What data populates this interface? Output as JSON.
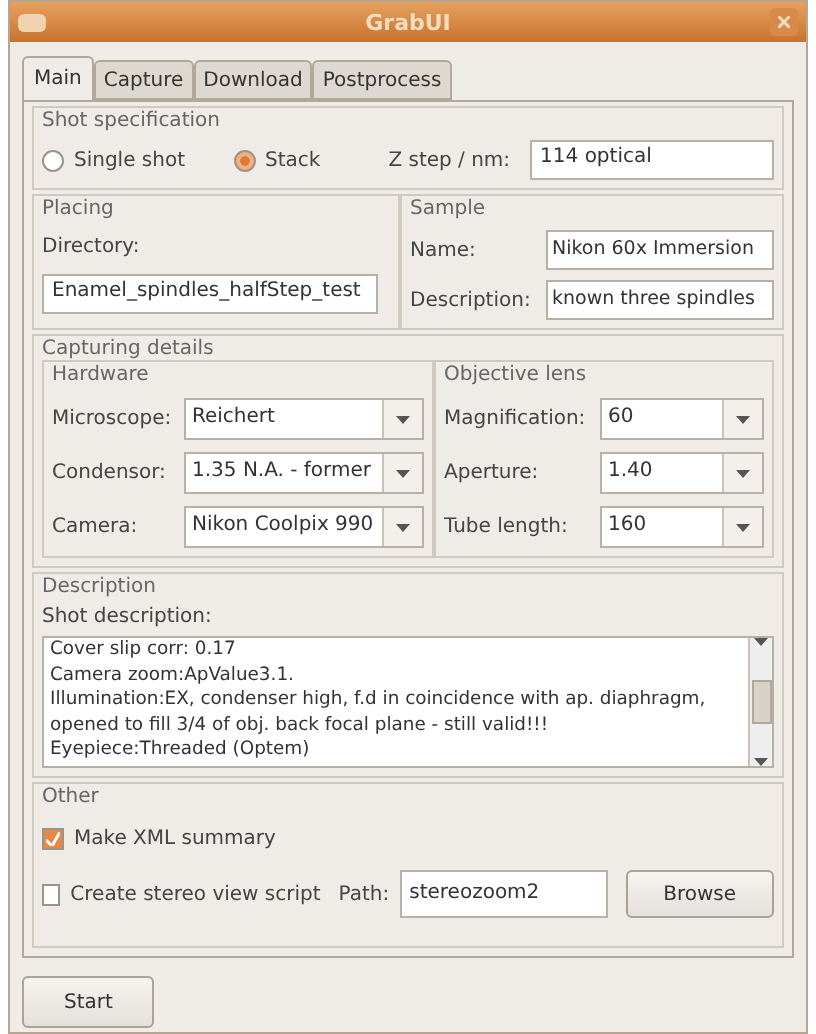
{
  "window": {
    "title": "GrabUI"
  },
  "tabs": [
    {
      "label": "Main",
      "selected": true
    },
    {
      "label": "Capture",
      "selected": false
    },
    {
      "label": "Download",
      "selected": false
    },
    {
      "label": "Postprocess",
      "selected": false
    }
  ],
  "shot_specification": {
    "title": "Shot specification",
    "options": [
      {
        "label": "Single shot",
        "selected": false
      },
      {
        "label": "Stack",
        "selected": true
      }
    ],
    "z_step": {
      "label": "Z step / nm:",
      "value": "114 optical"
    }
  },
  "placing": {
    "title": "Placing",
    "label": "Directory:",
    "value": "Enamel_spindles_halfStep_test"
  },
  "sample": {
    "title": "Sample",
    "fields": [
      {
        "label": "Name:",
        "value": "Nikon 60x Immersion"
      },
      {
        "label": "Description:",
        "value": "known three spindles"
      }
    ]
  },
  "capturing_details": {
    "title": "Capturing details",
    "hardware": {
      "title": "Hardware",
      "fields": [
        {
          "label": "Microscope:",
          "value": "Reichert"
        },
        {
          "label": "Condensor:",
          "value": "1.35 N.A. - former"
        },
        {
          "label": "Camera:",
          "value": "Nikon Coolpix 990"
        }
      ]
    },
    "objective_lens": {
      "title": "Objective lens",
      "fields": [
        {
          "label": "Magnification:",
          "value": "60"
        },
        {
          "label": "Aperture:",
          "value": "1.40"
        },
        {
          "label": "Tube length:",
          "value": "160"
        }
      ]
    }
  },
  "description": {
    "title": "Description",
    "label": "Shot description:",
    "lines": [
      "Cover slip corr: 0.17",
      "Camera zoom:ApValue3.1.",
      "Illumination:EX, condenser high, f.d in coincidence with ap. diaphragm,",
      "opened to fill 3/4 of obj. back focal plane - still valid!!!",
      "Eyepiece:Threaded (Optem)"
    ]
  },
  "other": {
    "title": "Other",
    "xml_summary": {
      "label": "Make XML summary",
      "checked": true
    },
    "stereo": {
      "label": "Create stereo view script",
      "checked": false
    },
    "path": {
      "label": "Path:",
      "value": "stereozoom2"
    },
    "browse": "Browse"
  },
  "start": "Start"
}
